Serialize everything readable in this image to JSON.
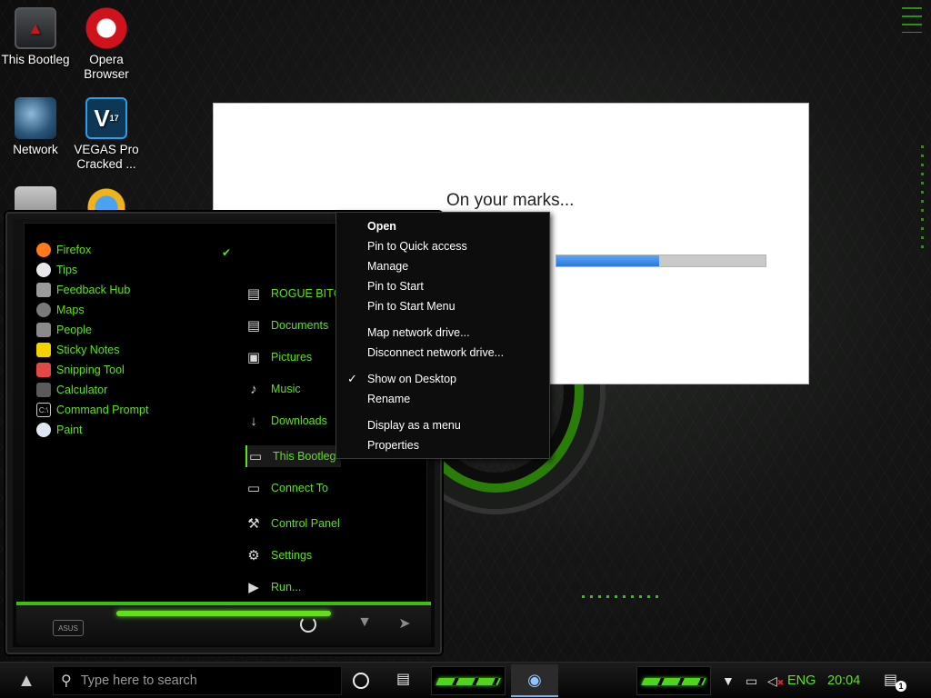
{
  "desktop": {
    "icons": [
      {
        "label": "This Bootleg",
        "icon": "pc-icon"
      },
      {
        "label": "Opera Browser",
        "icon": "opera-icon"
      },
      {
        "label": "Network",
        "icon": "network-icon"
      },
      {
        "label": "VEGAS Pro Cracked ...",
        "icon": "vegas-icon",
        "badge": "17"
      },
      {
        "label": "",
        "icon": "recycle-bin-icon"
      },
      {
        "label": "",
        "icon": "internet-icon"
      }
    ]
  },
  "dialog": {
    "title": "On your marks...",
    "progress": 0.49
  },
  "start_menu": {
    "apps": [
      {
        "label": "Firefox",
        "icon": "firefox-icon"
      },
      {
        "label": "Tips",
        "icon": "tips-icon"
      },
      {
        "label": "Feedback Hub",
        "icon": "feedback-hub-icon"
      },
      {
        "label": "Maps",
        "icon": "maps-icon"
      },
      {
        "label": "People",
        "icon": "people-icon"
      },
      {
        "label": "Sticky Notes",
        "icon": "sticky-notes-icon"
      },
      {
        "label": "Snipping Tool",
        "icon": "snipping-tool-icon"
      },
      {
        "label": "Calculator",
        "icon": "calculator-icon"
      },
      {
        "label": "Command Prompt",
        "icon": "command-prompt-icon"
      },
      {
        "label": "Paint",
        "icon": "paint-icon"
      }
    ],
    "places": [
      {
        "label": "ROGUE BITCH",
        "icon": "user-folder-icon"
      },
      {
        "label": "Documents",
        "icon": "documents-icon"
      },
      {
        "label": "Pictures",
        "icon": "pictures-icon"
      },
      {
        "label": "Music",
        "icon": "music-icon"
      },
      {
        "label": "Downloads",
        "icon": "downloads-icon"
      },
      {
        "label": "This Bootleg",
        "icon": "computer-icon"
      },
      {
        "label": "Connect To",
        "icon": "connect-icon"
      },
      {
        "label": "Control Panel",
        "icon": "control-panel-icon"
      },
      {
        "label": "Settings",
        "icon": "settings-icon"
      },
      {
        "label": "Run...",
        "icon": "run-icon"
      }
    ],
    "selected_place": "This Bootleg",
    "logo_text": "ASUS"
  },
  "context_menu": {
    "items": [
      {
        "label": "Open",
        "bold": true,
        "checked": false
      },
      {
        "label": "Pin to Quick access",
        "bold": false,
        "checked": false
      },
      {
        "label": "Manage",
        "bold": false,
        "checked": false
      },
      {
        "label": "Pin to Start",
        "bold": false,
        "checked": false
      },
      {
        "label": "Pin to Start Menu",
        "bold": false,
        "checked": false
      },
      {
        "label": "Map network drive...",
        "bold": false,
        "checked": false
      },
      {
        "label": "Disconnect network drive...",
        "bold": false,
        "checked": false
      },
      {
        "label": "Show on Desktop",
        "bold": false,
        "checked": true
      },
      {
        "label": "Rename",
        "bold": false,
        "checked": false
      },
      {
        "label": "Display as a menu",
        "bold": false,
        "checked": false
      },
      {
        "label": "Properties",
        "bold": false,
        "checked": false
      }
    ]
  },
  "taskbar": {
    "search_placeholder": "Type here to search",
    "language": "ENG",
    "clock": "20:04",
    "notification_count": "1",
    "accent": "#5fe21a"
  }
}
